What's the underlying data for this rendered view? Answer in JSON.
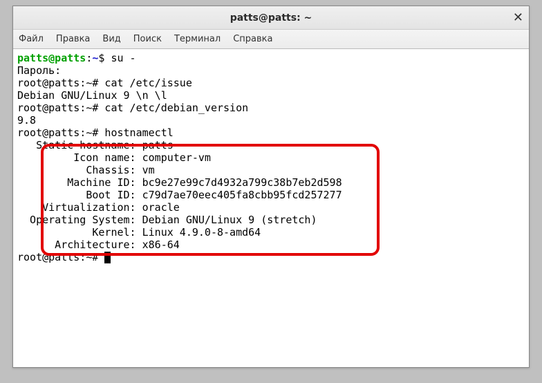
{
  "window": {
    "title": "patts@patts: ~"
  },
  "menu": {
    "file": "Файл",
    "edit": "Правка",
    "view": "Вид",
    "search": "Поиск",
    "terminal": "Терминал",
    "help": "Справка"
  },
  "lines": {
    "l0_user": "patts@patts",
    "l0_colon": ":",
    "l0_path": "~",
    "l0_rest": "$ su -",
    "l1": "Пароль:",
    "l2": "root@patts:~# cat /etc/issue",
    "l3": "Debian GNU/Linux 9 \\n \\l",
    "l4": "",
    "l5": "root@patts:~# cat /etc/debian_version",
    "l6": "9.8",
    "l7": "root@patts:~# hostnamectl",
    "l8": "   Static hostname: patts",
    "l9": "         Icon name: computer-vm",
    "l10": "           Chassis: vm",
    "l11": "        Machine ID: bc9e27e99c7d4932a799c38b7eb2d598",
    "l12": "           Boot ID: c79d7ae70eec405fa8cbb95fcd257277",
    "l13": "    Virtualization: oracle",
    "l14": "  Operating System: Debian GNU/Linux 9 (stretch)",
    "l15": "            Kernel: Linux 4.9.0-8-amd64",
    "l16": "      Architecture: x86-64",
    "l17": "root@patts:~# "
  }
}
